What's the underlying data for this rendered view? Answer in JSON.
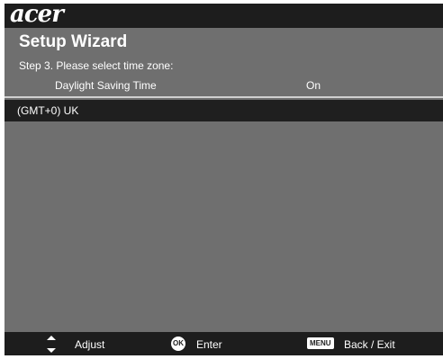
{
  "logo": "acer",
  "title": "Setup Wizard",
  "step_text": "Step 3. Please select time zone:",
  "dst": {
    "label": "Daylight Saving Time",
    "value": "On"
  },
  "timezone": {
    "selected": "(GMT+0) UK"
  },
  "footer": {
    "adjust_label": "Adjust",
    "ok_icon_text": "OK",
    "enter_label": "Enter",
    "menu_icon_text": "MENU",
    "back_label": "Back / Exit"
  },
  "icons": {
    "adjust": "up-down-arrows-icon",
    "enter": "ok-button-icon",
    "back": "menu-button-icon"
  },
  "colors": {
    "panel": "#6f6f6f",
    "bars": "#1d1d1d",
    "selected_row": "#1f1f1f",
    "text": "#ffffff"
  }
}
